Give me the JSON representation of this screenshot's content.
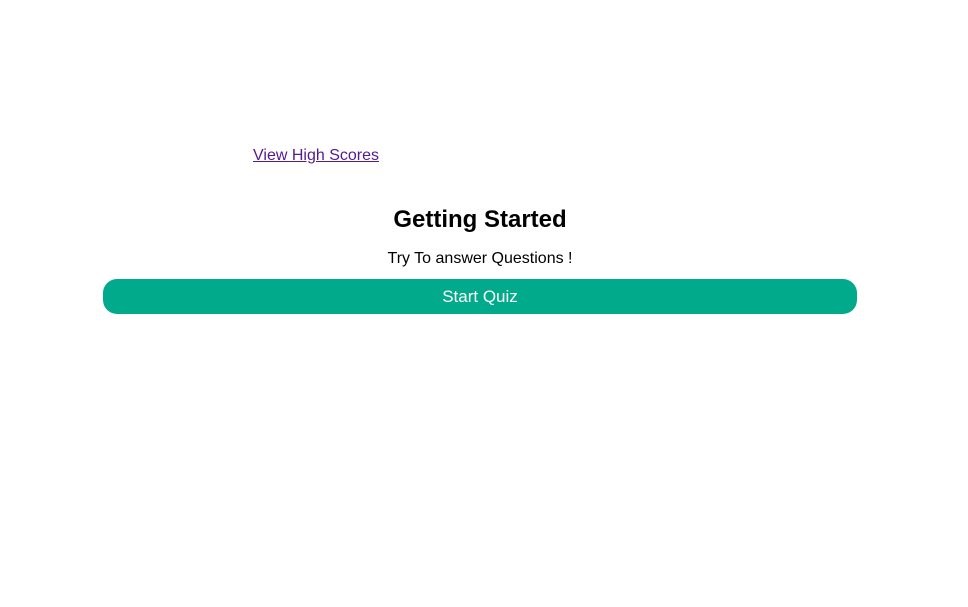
{
  "header": {
    "high_scores_link": "View High Scores"
  },
  "main": {
    "title": "Getting Started",
    "subtitle": "Try To answer Questions !",
    "start_button": "Start Quiz"
  },
  "colors": {
    "accent": "#00aa8b",
    "link": "#551a8b"
  }
}
